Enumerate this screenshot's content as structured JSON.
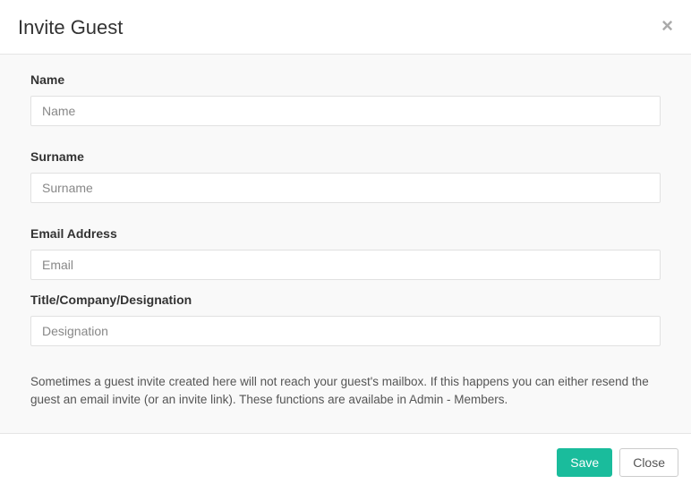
{
  "modal": {
    "title": "Invite Guest",
    "close_label": "×"
  },
  "form": {
    "name": {
      "label": "Name",
      "placeholder": "Name"
    },
    "surname": {
      "label": "Surname",
      "placeholder": "Surname"
    },
    "email": {
      "label": "Email Address",
      "placeholder": "Email"
    },
    "designation": {
      "label": "Title/Company/Designation",
      "placeholder": "Designation"
    },
    "help_text": "Sometimes a guest invite created here will not reach your guest's mailbox. If this happens you can either resend the guest an email invite (or an invite link). These functions are availabe in Admin - Members."
  },
  "footer": {
    "save_label": "Save",
    "close_label": "Close"
  }
}
